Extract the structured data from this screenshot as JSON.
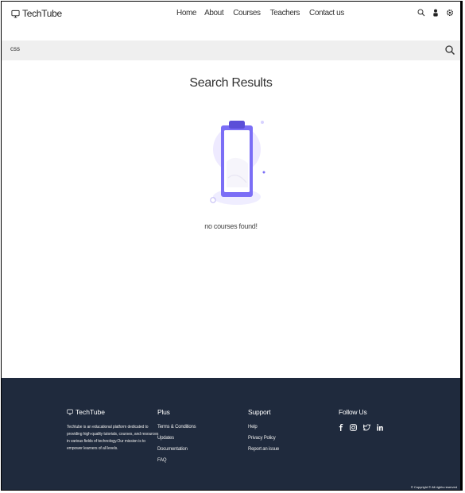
{
  "navbar": {
    "brand": "TechTube",
    "links": [
      "Home",
      "About",
      "Courses",
      "Teachers",
      "Contact us"
    ]
  },
  "search": {
    "query": "css"
  },
  "main": {
    "title": "Search Results",
    "empty_message": "no courses found!"
  },
  "footer": {
    "brand": "TechTube",
    "description": "Techtube is an educational platform dedicated to providing high-quality tutorials, courses, and resources in various fields of technology.Our mission is to empower learners of all levels.",
    "plus": {
      "title": "Plus",
      "links": [
        "Terms & Conditions",
        "Updates",
        "Documentation",
        "FAQ"
      ]
    },
    "support": {
      "title": "Support",
      "links": [
        "Help",
        "Privacy Policy",
        "Report an issue"
      ]
    },
    "follow": {
      "title": "Follow Us",
      "icons": [
        "facebook-icon",
        "instagram-icon",
        "twitter-icon",
        "linkedin-icon"
      ]
    },
    "copyright": "© Copyright © All rights reserved"
  },
  "colors": {
    "footer_bg": "#1f2a3d",
    "search_bg": "#efefef",
    "accent": "#7b6ef6"
  }
}
